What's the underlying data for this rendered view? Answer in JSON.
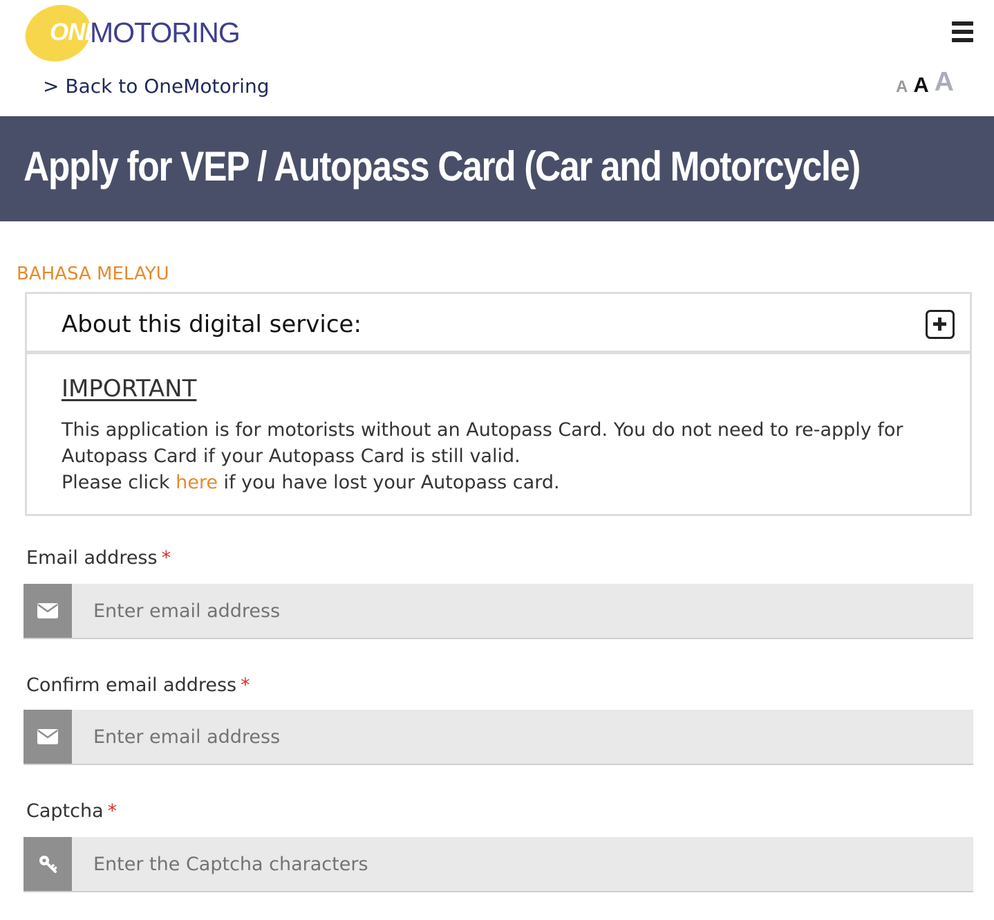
{
  "header": {
    "logo_one": "ONE",
    "logo_motoring": "MOTORING",
    "back_link": "> Back to OneMotoring",
    "font_size_controls": [
      "A",
      "A",
      "A"
    ]
  },
  "banner": {
    "title": "Apply for VEP / Autopass Card (Car and Motorcycle)"
  },
  "language_link": "BAHASA MELAYU",
  "about": {
    "title": "About this digital service:",
    "important_heading": "IMPORTANT",
    "line1": "This application is for motorists without an Autopass Card. You do not need to re-apply for Autopass Card if your Autopass Card is still valid.",
    "line2_before": "Please click ",
    "line2_link": "here",
    "line2_after": " if you have lost your Autopass card."
  },
  "form": {
    "email": {
      "label": "Email address",
      "required_mark": "*",
      "placeholder": "Enter email address",
      "icon": "envelope-icon"
    },
    "confirm_email": {
      "label": "Confirm email address",
      "required_mark": "*",
      "placeholder": "Enter email address",
      "icon": "envelope-icon"
    },
    "captcha": {
      "label": "Captcha",
      "required_mark": "*",
      "placeholder": "Enter the Captcha characters",
      "icon": "key-icon"
    }
  },
  "colors": {
    "banner_bg": "#4a4f69",
    "accent_orange": "#e8892b",
    "logo_yellow": "#f7d64b",
    "logo_blue": "#3f3f8e",
    "required_red": "#d9332b",
    "input_bg": "#e9e9e9",
    "addon_bg": "#8f8f8f"
  }
}
